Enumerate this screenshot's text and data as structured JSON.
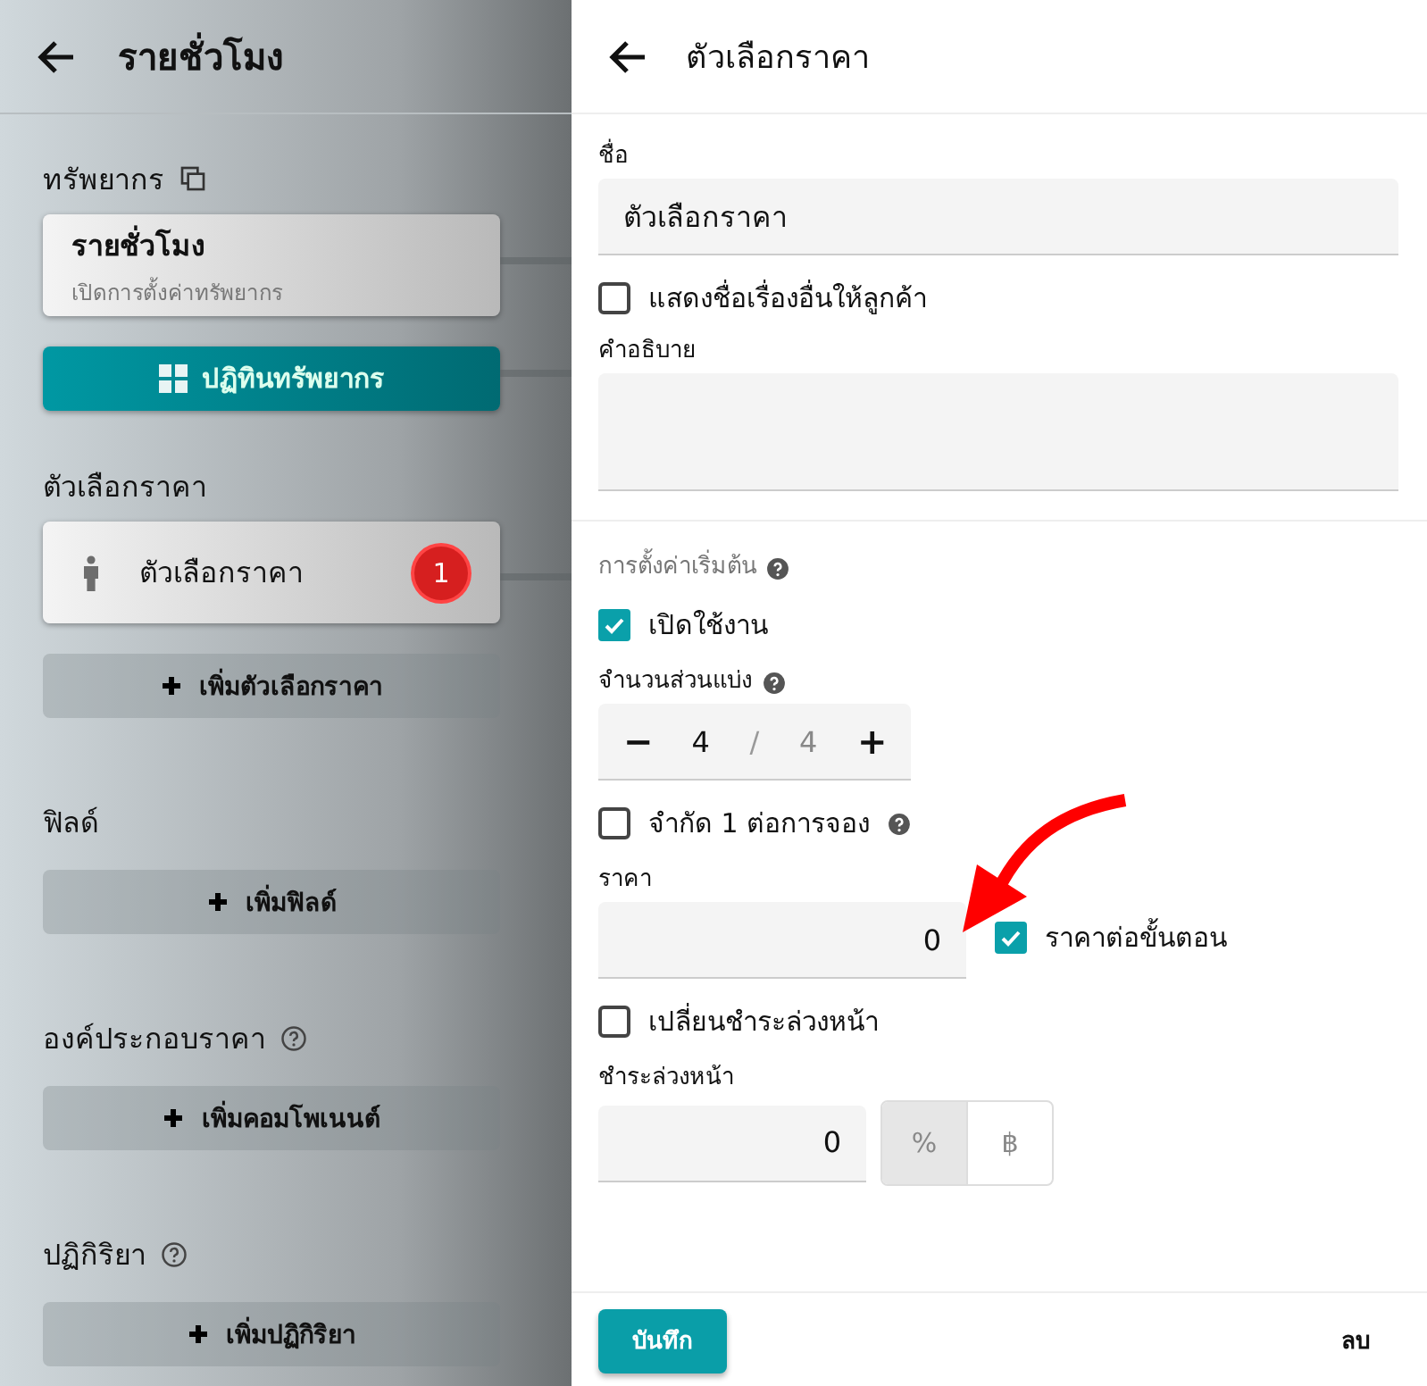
{
  "left": {
    "title": "รายชั่วโมง",
    "resource": {
      "heading": "ทรัพยากร",
      "card_title": "รายชั่วโมง",
      "card_subtitle": "เปิดการตั้งค่าทรัพยากร",
      "calendar_button": "ปฏิทินทรัพยากร"
    },
    "sections": [
      {
        "heading": "ตัวเลือกราคา",
        "help": false,
        "items": [
          {
            "label": "ตัวเลือกราคา",
            "badge": "1"
          }
        ],
        "add_button": "เพิ่มตัวเลือกราคา"
      },
      {
        "heading": "ฟิลด์",
        "help": false,
        "add_button": "เพิ่มฟิลด์"
      },
      {
        "heading": "องค์ประกอบราคา",
        "help": true,
        "add_button": "เพิ่มคอมโพเนนต์"
      },
      {
        "heading": "ปฏิกิริยา",
        "help": true,
        "add_button": "เพิ่มปฏิกิริยา"
      }
    ]
  },
  "right": {
    "title": "ตัวเลือกราคา",
    "form": [
      {
        "kind": "field",
        "label": "ชื่อ",
        "value": "ตัวเลือกราคา"
      },
      {
        "kind": "checkbox",
        "label": "แสดงชื่อเรื่องอื่นให้ลูกค้า",
        "checked": false,
        "help": false
      },
      {
        "kind": "textarea",
        "label": "คำอธิบาย"
      },
      {
        "kind": "divider"
      },
      {
        "kind": "section",
        "label": "การตั้งค่าเริ่มต้น",
        "help": true
      },
      {
        "kind": "checkbox",
        "label": "เปิดใช้งาน",
        "checked": true,
        "help": false
      },
      {
        "kind": "stepper",
        "label": "จำนวนส่วนแบ่ง",
        "help": true,
        "minus": "−",
        "value": "4",
        "separator": "/",
        "total": "4",
        "plus": "+"
      },
      {
        "kind": "checkbox",
        "label": "จำกัด 1 ต่อการจอง",
        "checked": false,
        "help": true
      },
      {
        "kind": "price",
        "label": "ราคา",
        "value": "0",
        "check_label": "ราคาต่อขั้นตอน",
        "checked": true
      },
      {
        "kind": "checkbox",
        "label": "เปลี่ยนชำระล่วงหน้า",
        "checked": false,
        "help": false
      },
      {
        "kind": "deposit",
        "label": "ชำระล่วงหน้า",
        "value": "0",
        "units": [
          {
            "label": "%",
            "selected": true
          },
          {
            "label": "฿",
            "selected": false
          }
        ]
      }
    ],
    "save": "บันทึก",
    "delete": "ลบ"
  }
}
